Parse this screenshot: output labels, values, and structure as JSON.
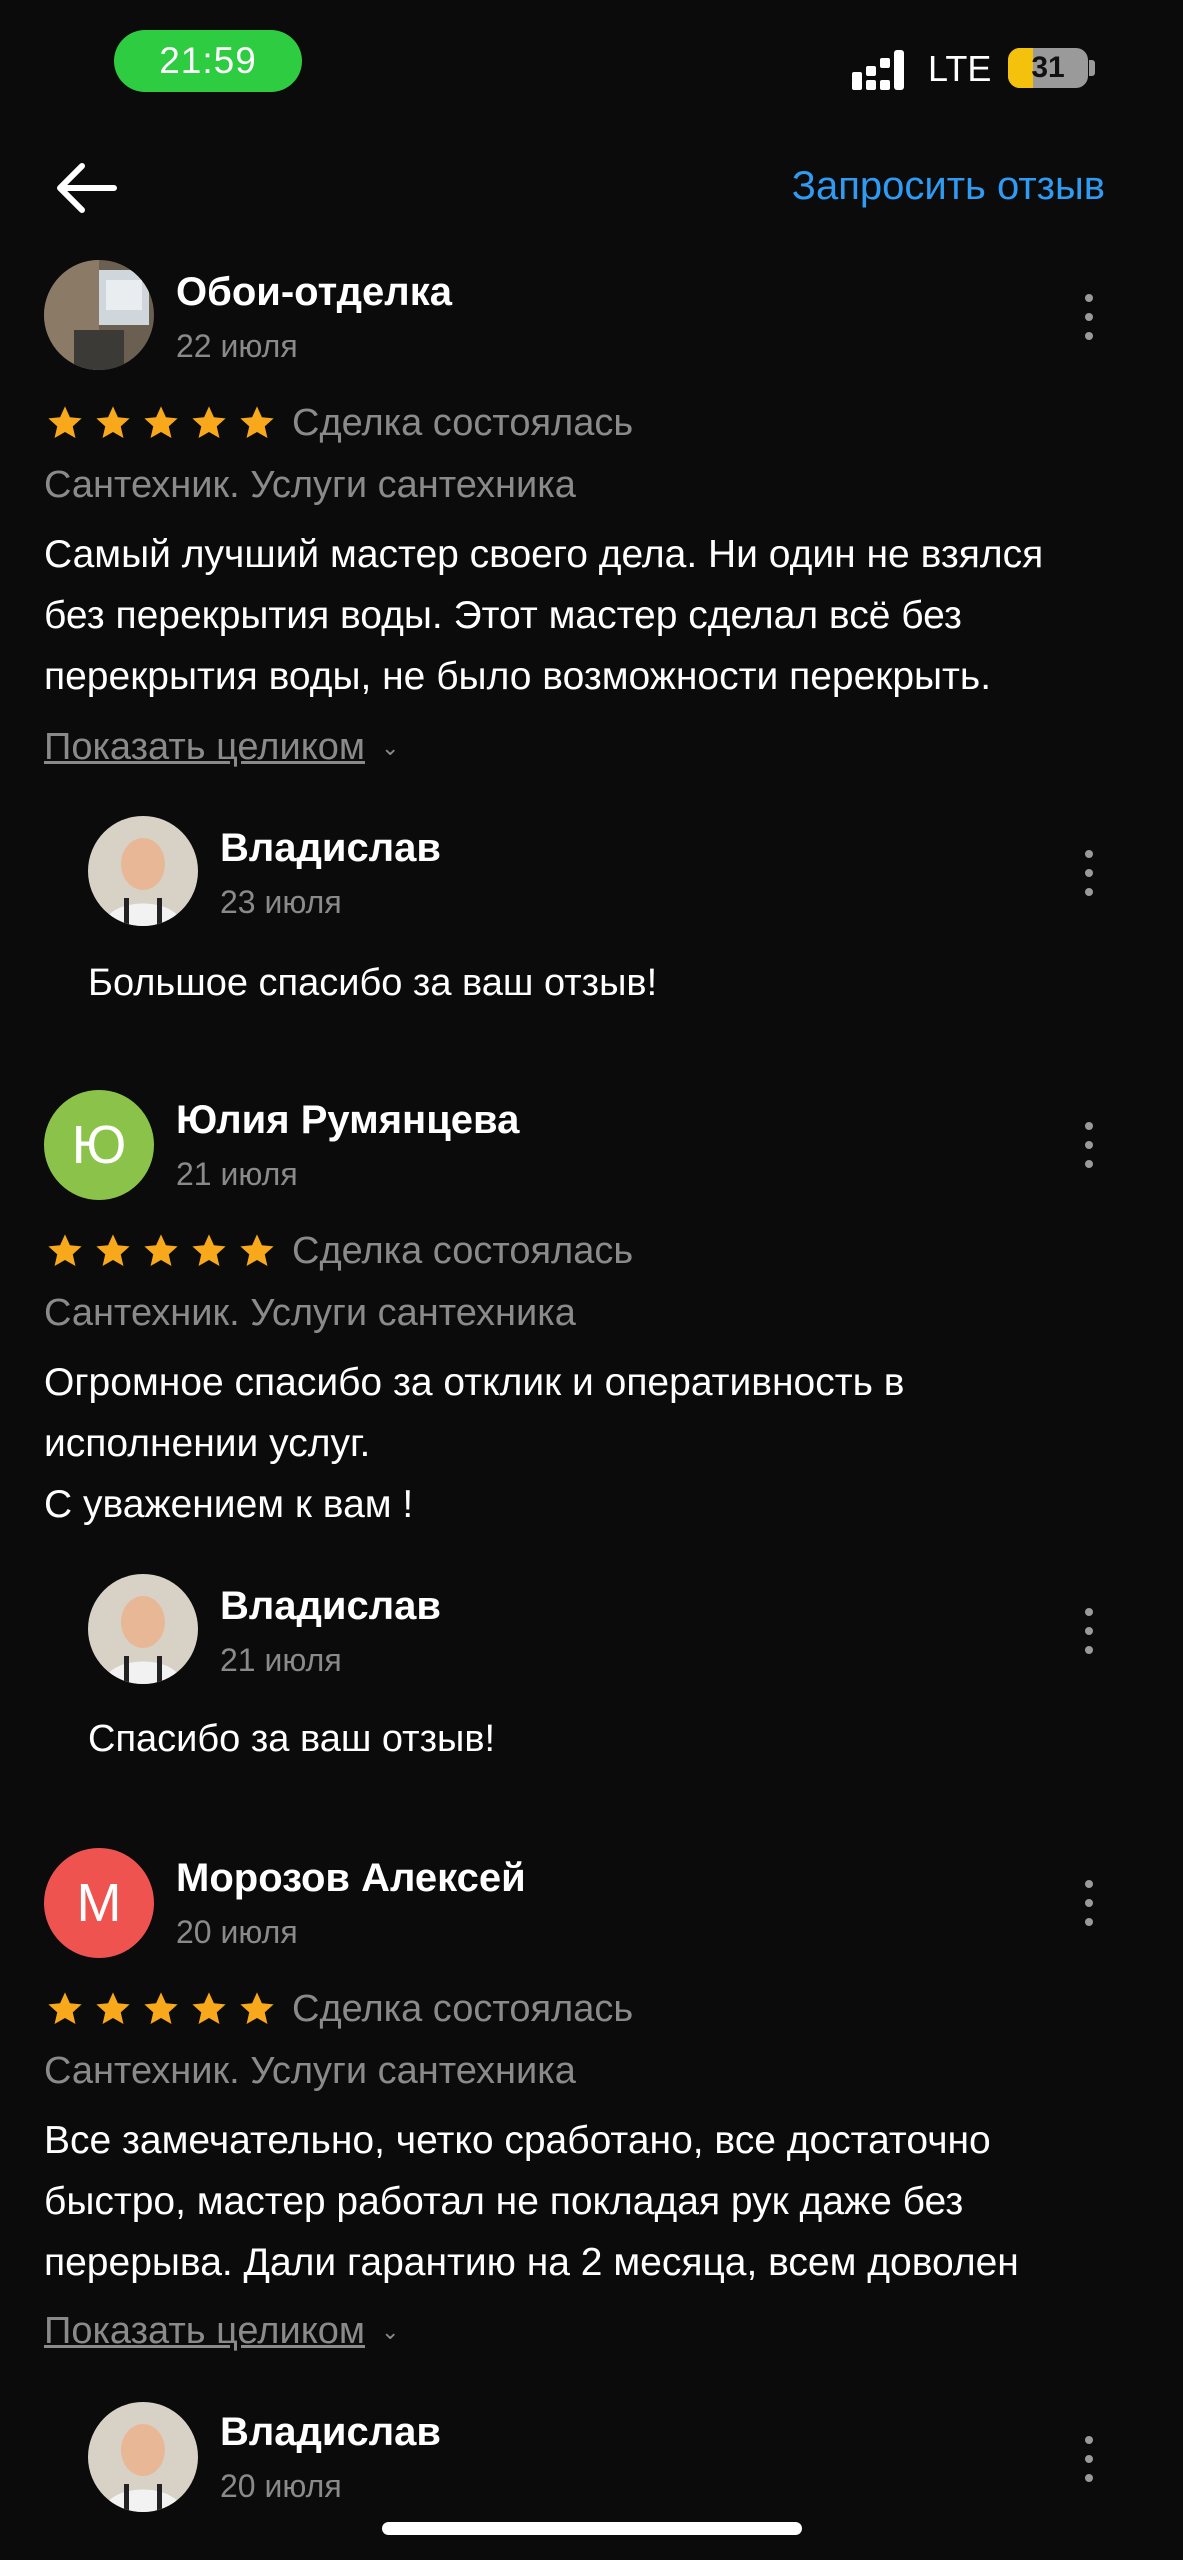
{
  "status_bar": {
    "time": "21:59",
    "network": "LTE",
    "battery": "31",
    "battery_level": 0.31
  },
  "nav": {
    "back_icon": "arrow-left-icon",
    "request_link": "Запросить отзыв"
  },
  "colors": {
    "accent": "#2f9bf2",
    "star": "#f7a81b",
    "time_pill": "#2ecc40",
    "avatar_yu": "#8bc34a",
    "avatar_m": "#ef5350"
  },
  "reviews": [
    {
      "author": "Обои-отделка",
      "date": "22 июля",
      "rating": 5,
      "status": "Сделка состоялась",
      "category": "Сантехник. Услуги сантехника",
      "text_lines": [
        "Самый лучший мастер своего дела. Ни один не взялся",
        "без перекрытия воды. Этот мастер сделал всё без",
        "перекрытия воды, не было  возможности перекрыть."
      ],
      "show_more": "Показать целиком",
      "reply": {
        "author": "Владислав",
        "date": "23 июля",
        "text": "Большое спасибо за ваш отзыв!"
      }
    },
    {
      "author": "Юлия Румянцева",
      "initial": "Ю",
      "date": "21 июля",
      "rating": 5,
      "status": "Сделка состоялась",
      "category": "Сантехник. Услуги сантехника",
      "text_lines": [
        "Огромное спасибо за отклик и оперативность в",
        "исполнении услуг.",
        "С уважением к вам !"
      ],
      "reply": {
        "author": "Владислав",
        "date": "21 июля",
        "text": "Спасибо за ваш отзыв!"
      }
    },
    {
      "author": "Морозов Алексей",
      "initial": "М",
      "date": "20 июля",
      "rating": 5,
      "status": "Сделка состоялась",
      "category": "Сантехник. Услуги сантехника",
      "text_lines": [
        "Все замечательно, четко сработано, все достаточно",
        "быстро, мастер работал не покладая рук даже без",
        "перерыва. Дали гарантию на 2 месяца, всем доволен"
      ],
      "show_more": "Показать целиком",
      "reply": {
        "author": "Владислав",
        "date": "20 июля"
      }
    }
  ]
}
